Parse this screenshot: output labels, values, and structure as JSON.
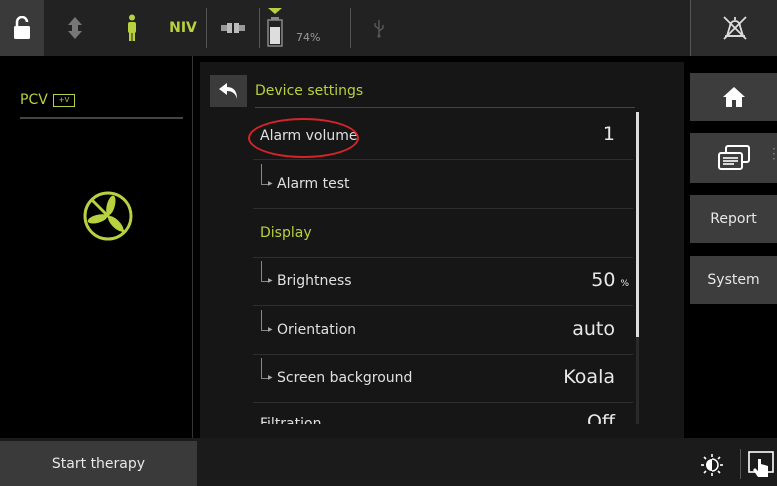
{
  "topbar": {
    "icons": [
      "lock-icon",
      "sort-arrows-icon",
      "patient-icon",
      "niv-label",
      "tube-connector-icon",
      "battery-icon",
      "usb-icon",
      "alarm-off-icon"
    ],
    "niv_label": "NIV",
    "battery_percent": "74%"
  },
  "left_panel": {
    "mode": "PCV",
    "mode_badge": "+V",
    "status_icon": "no-fan-icon"
  },
  "settings": {
    "title": "Device settings",
    "back_icon": "back-arrow-icon",
    "rows": [
      {
        "label": "Alarm volume",
        "value": "1",
        "unit": ""
      },
      {
        "label": "Alarm test",
        "value": "",
        "unit": ""
      },
      {
        "label": "Display",
        "value": "",
        "unit": ""
      },
      {
        "label": "Brightness",
        "value": "50",
        "unit": "%"
      },
      {
        "label": "Orientation",
        "value": "auto",
        "unit": ""
      },
      {
        "label": "Screen background",
        "value": "Koala",
        "unit": ""
      },
      {
        "label": "Filtration",
        "value": "Off",
        "unit": ""
      }
    ]
  },
  "right_buttons": {
    "home_icon": "home-icon",
    "keyboard_icon": "screens-icon",
    "report": "Report",
    "system": "System"
  },
  "bottom": {
    "start_therapy": "Start therapy",
    "brightness_icon": "brightness-icon",
    "touch_lock_icon": "touch-icon"
  },
  "colors": {
    "accent": "#b8d13f",
    "annotation": "#d8232a",
    "button": "#3d3d3d"
  }
}
